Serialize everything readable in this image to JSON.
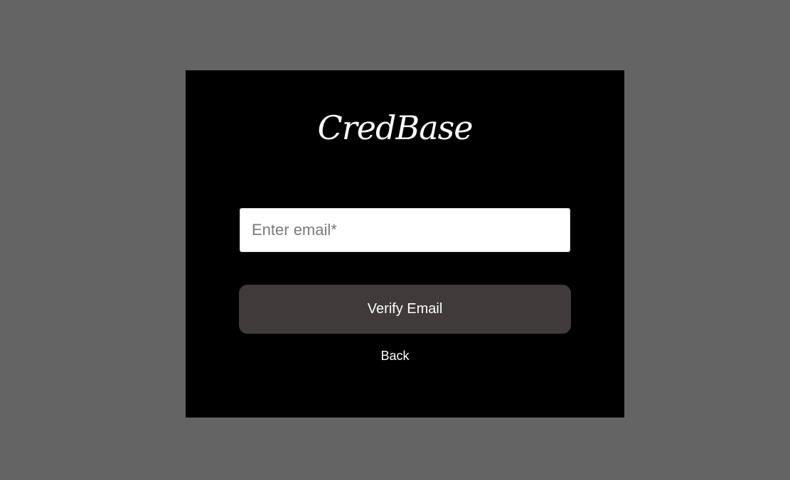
{
  "brand": {
    "logo_text": "CredBase"
  },
  "form": {
    "email_placeholder": "Enter email*",
    "email_value": "",
    "verify_label": "Verify Email",
    "back_label": "Back"
  },
  "colors": {
    "page_background": "#646464",
    "card_background": "#000000",
    "button_background": "#403a3a",
    "text": "#ffffff"
  }
}
